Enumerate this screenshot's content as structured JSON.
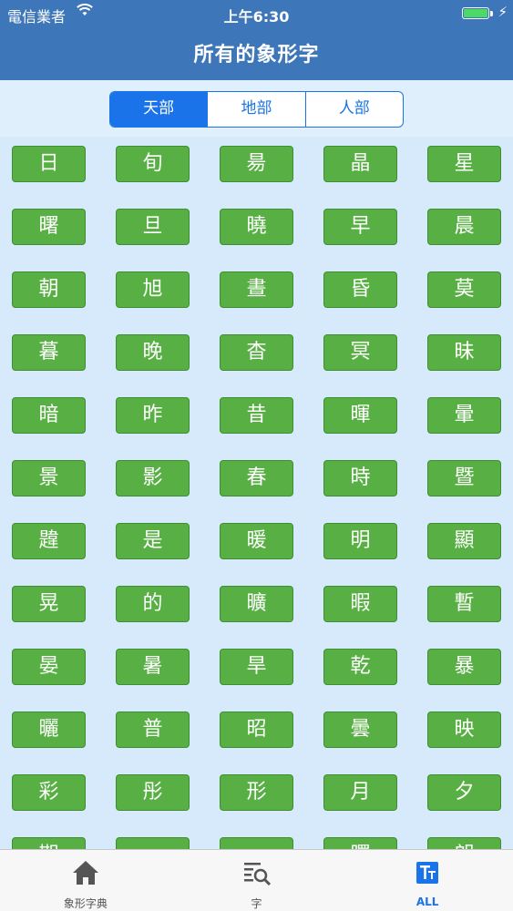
{
  "status_bar": {
    "carrier": "電信業者",
    "time": "上午6:30"
  },
  "header": {
    "title": "所有的象形字"
  },
  "segments": [
    {
      "label": "天部",
      "active": true
    },
    {
      "label": "地部",
      "active": false
    },
    {
      "label": "人部",
      "active": false
    }
  ],
  "characters": [
    "日",
    "旬",
    "昜",
    "晶",
    "星",
    "曙",
    "旦",
    "曉",
    "早",
    "晨",
    "朝",
    "旭",
    "晝",
    "昏",
    "莫",
    "暮",
    "晚",
    "杳",
    "冥",
    "昧",
    "暗",
    "昨",
    "昔",
    "暉",
    "暈",
    "景",
    "影",
    "春",
    "時",
    "暨",
    "韙",
    "是",
    "暖",
    "明",
    "顯",
    "晃",
    "的",
    "曠",
    "暇",
    "暫",
    "晏",
    "暑",
    "旱",
    "乾",
    "暴",
    "曬",
    "普",
    "昭",
    "曇",
    "映",
    "彩",
    "彤",
    "形",
    "月",
    "夕",
    "期",
    "",
    "",
    "曙",
    "朗"
  ],
  "tabs": [
    {
      "label": "象形字典",
      "icon": "home-icon",
      "active": false
    },
    {
      "label": "字",
      "icon": "search-list-icon",
      "active": false
    },
    {
      "label": "ALL",
      "icon": "text-size-icon",
      "active": true
    }
  ],
  "colors": {
    "header": "#3d77b9",
    "accent": "#1a73e8",
    "cell": "#58b044",
    "background": "#d6eafb"
  }
}
